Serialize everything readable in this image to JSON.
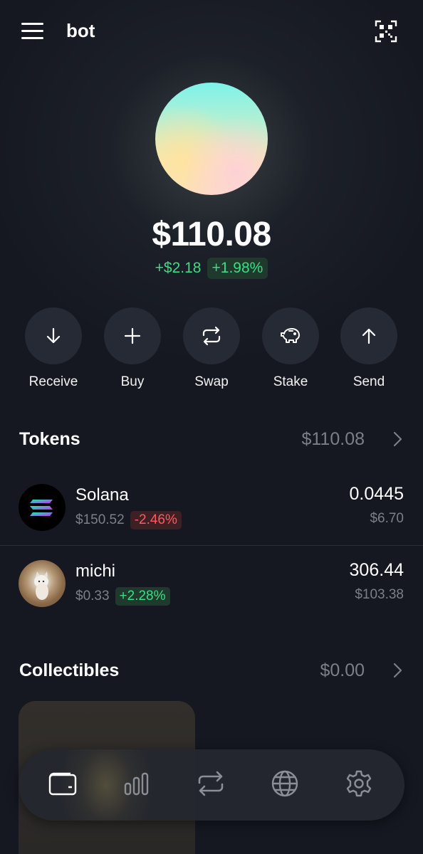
{
  "header": {
    "account_name": "bot",
    "menu_icon": "hamburger-menu-icon",
    "qr_icon": "qr-scan-icon"
  },
  "portfolio": {
    "balance": "$110.08",
    "change_amount": "+$2.18",
    "change_percent": "+1.98%"
  },
  "actions": [
    {
      "label": "Receive",
      "icon": "arrow-down-icon"
    },
    {
      "label": "Buy",
      "icon": "plus-icon"
    },
    {
      "label": "Swap",
      "icon": "swap-icon"
    },
    {
      "label": "Stake",
      "icon": "piggy-bank-icon"
    },
    {
      "label": "Send",
      "icon": "arrow-up-icon"
    }
  ],
  "tokens": {
    "title": "Tokens",
    "total": "$110.08",
    "items": [
      {
        "name": "Solana",
        "price": "$150.52",
        "change": "-2.46%",
        "amount": "0.0445",
        "value": "$6.70"
      },
      {
        "name": "michi",
        "price": "$0.33",
        "change": "+2.28%",
        "amount": "306.44",
        "value": "$103.38"
      }
    ]
  },
  "collectibles": {
    "title": "Collectibles",
    "total": "$0.00"
  },
  "tabbar": [
    {
      "name": "wallet",
      "icon": "wallet-icon",
      "active": true
    },
    {
      "name": "explore",
      "icon": "bar-chart-icon",
      "active": false
    },
    {
      "name": "swap",
      "icon": "swap-icon",
      "active": false
    },
    {
      "name": "browser",
      "icon": "globe-icon",
      "active": false
    },
    {
      "name": "settings",
      "icon": "gear-icon",
      "active": false
    }
  ],
  "colors": {
    "background": "#151821",
    "positive": "#3ddc84",
    "negative": "#ff5a5f",
    "muted": "#7b7f88",
    "button": "#262a34"
  }
}
